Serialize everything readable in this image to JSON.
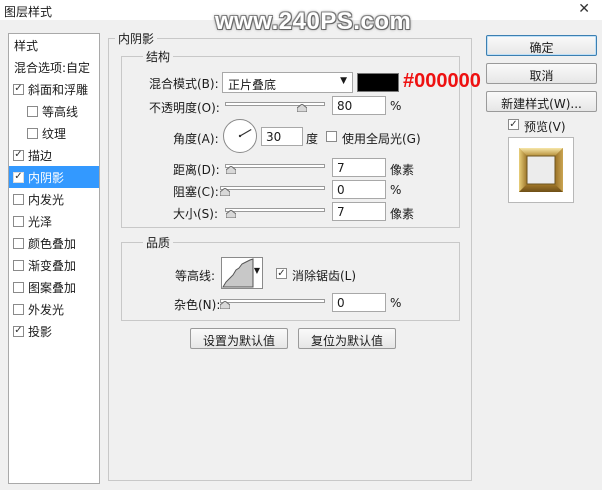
{
  "window": {
    "title": "图层样式",
    "close_glyph": "✕"
  },
  "watermark": "www.240PS.com",
  "sidebar": {
    "header": "样式",
    "blend_options": "混合选项:自定",
    "items": [
      {
        "label": "斜面和浮雕",
        "checked": true
      },
      {
        "label": "等高线",
        "checked": false
      },
      {
        "label": "纹理",
        "checked": false
      },
      {
        "label": "描边",
        "checked": true
      },
      {
        "label": "内阴影",
        "checked": true,
        "selected": true
      },
      {
        "label": "内发光",
        "checked": false
      },
      {
        "label": "光泽",
        "checked": false
      },
      {
        "label": "颜色叠加",
        "checked": false
      },
      {
        "label": "渐变叠加",
        "checked": false
      },
      {
        "label": "图案叠加",
        "checked": false
      },
      {
        "label": "外发光",
        "checked": false
      },
      {
        "label": "投影",
        "checked": true
      }
    ]
  },
  "panel": {
    "title": "内阴影",
    "structure": {
      "title": "结构",
      "blend_mode_label": "混合模式(B):",
      "blend_mode_value": "正片叠底",
      "color_hex_annotation": "#000000",
      "shadow_color": "#000000",
      "opacity_label": "不透明度(O):",
      "opacity_value": "80",
      "opacity_unit": "%",
      "opacity_fraction": 0.8,
      "angle_label": "角度(A):",
      "angle_value": "30",
      "angle_unit": "度",
      "global_light_label": "使用全局光(G)",
      "global_light_checked": false,
      "distance_label": "距离(D):",
      "distance_value": "7",
      "distance_unit": "像素",
      "choke_label": "阻塞(C):",
      "choke_value": "0",
      "choke_unit": "%",
      "size_label": "大小(S):",
      "size_value": "7",
      "size_unit": "像素"
    },
    "quality": {
      "title": "品质",
      "contour_label": "等高线:",
      "antialias_label": "消除锯齿(L)",
      "antialias_checked": true,
      "noise_label": "杂色(N):",
      "noise_value": "0",
      "noise_unit": "%"
    },
    "make_default": "设置为默认值",
    "reset_default": "复位为默认值"
  },
  "actions": {
    "ok": "确定",
    "cancel": "取消",
    "new_style": "新建样式(W)...",
    "preview_label": "预览(V)",
    "preview_checked": true
  }
}
